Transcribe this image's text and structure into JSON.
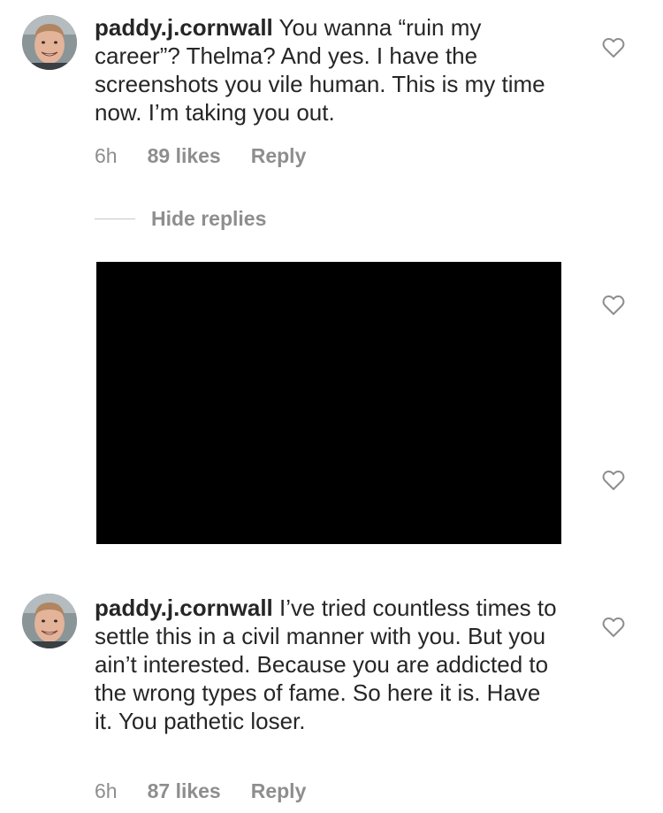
{
  "comments": [
    {
      "username": "paddy.j.cornwall",
      "text": "You wanna “ruin my career”? Thelma? And yes. I have the screenshots you vile human. This is my time now. I’m taking you out.",
      "time": "6h",
      "likes": "89 likes",
      "reply": "Reply"
    },
    {
      "username": "paddy.j.cornwall",
      "text": "I’ve tried countless times to settle this in a civil manner with you. But you ain’t interested. Because you are addicted to the wrong types of fame. So here it is. Have it. You pathetic loser.",
      "time": "6h",
      "likes": "87 likes",
      "reply": "Reply"
    }
  ],
  "replies_toggle": {
    "label": "Hide replies"
  },
  "icons": {
    "like": "heart-outline-icon",
    "avatar": "profile-photo"
  },
  "colors": {
    "text": "#262626",
    "secondary": "#8e8e8e",
    "redacted_block": "#000000"
  }
}
